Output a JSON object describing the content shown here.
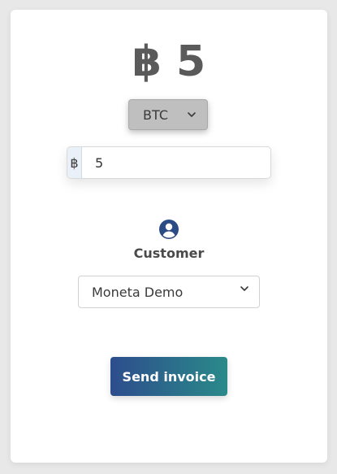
{
  "amount_display": {
    "symbol": "฿",
    "value": "5"
  },
  "currency_select": {
    "selected": "BTC"
  },
  "amount_input": {
    "prefix": "฿",
    "value": "5"
  },
  "customer": {
    "label": "Customer",
    "selected": "Moneta Demo"
  },
  "actions": {
    "send_label": "Send invoice"
  },
  "colors": {
    "gradient_start": "#2d4d8c",
    "gradient_end": "#2a8a8a",
    "icon": "#2b4b85"
  },
  "icons": {
    "currency_chevron": "chevron-down-icon",
    "customer": "user-circle-icon",
    "customer_chevron": "chevron-down-icon"
  }
}
